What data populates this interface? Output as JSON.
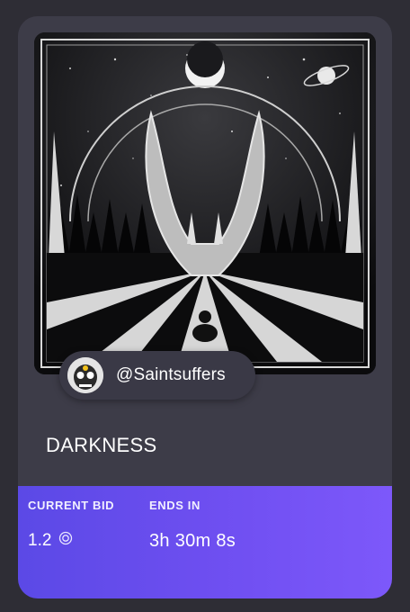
{
  "creator": {
    "handle": "@Saintsuffers",
    "avatar_icon": "skull-avatar"
  },
  "artwork": {
    "name": "DARKNESS"
  },
  "auction": {
    "current_bid_label": "CURRENT BID",
    "current_bid_value": "1.2",
    "currency_icon": "eth-circle-icon",
    "ends_in_label": "ENDS IN",
    "ends_in_value": "3h 30m 8s"
  },
  "colors": {
    "card_bg": "#3d3c48",
    "page_bg": "#2e2d35",
    "accent_gradient_start": "#5b49e6",
    "accent_gradient_end": "#7d58fa"
  }
}
